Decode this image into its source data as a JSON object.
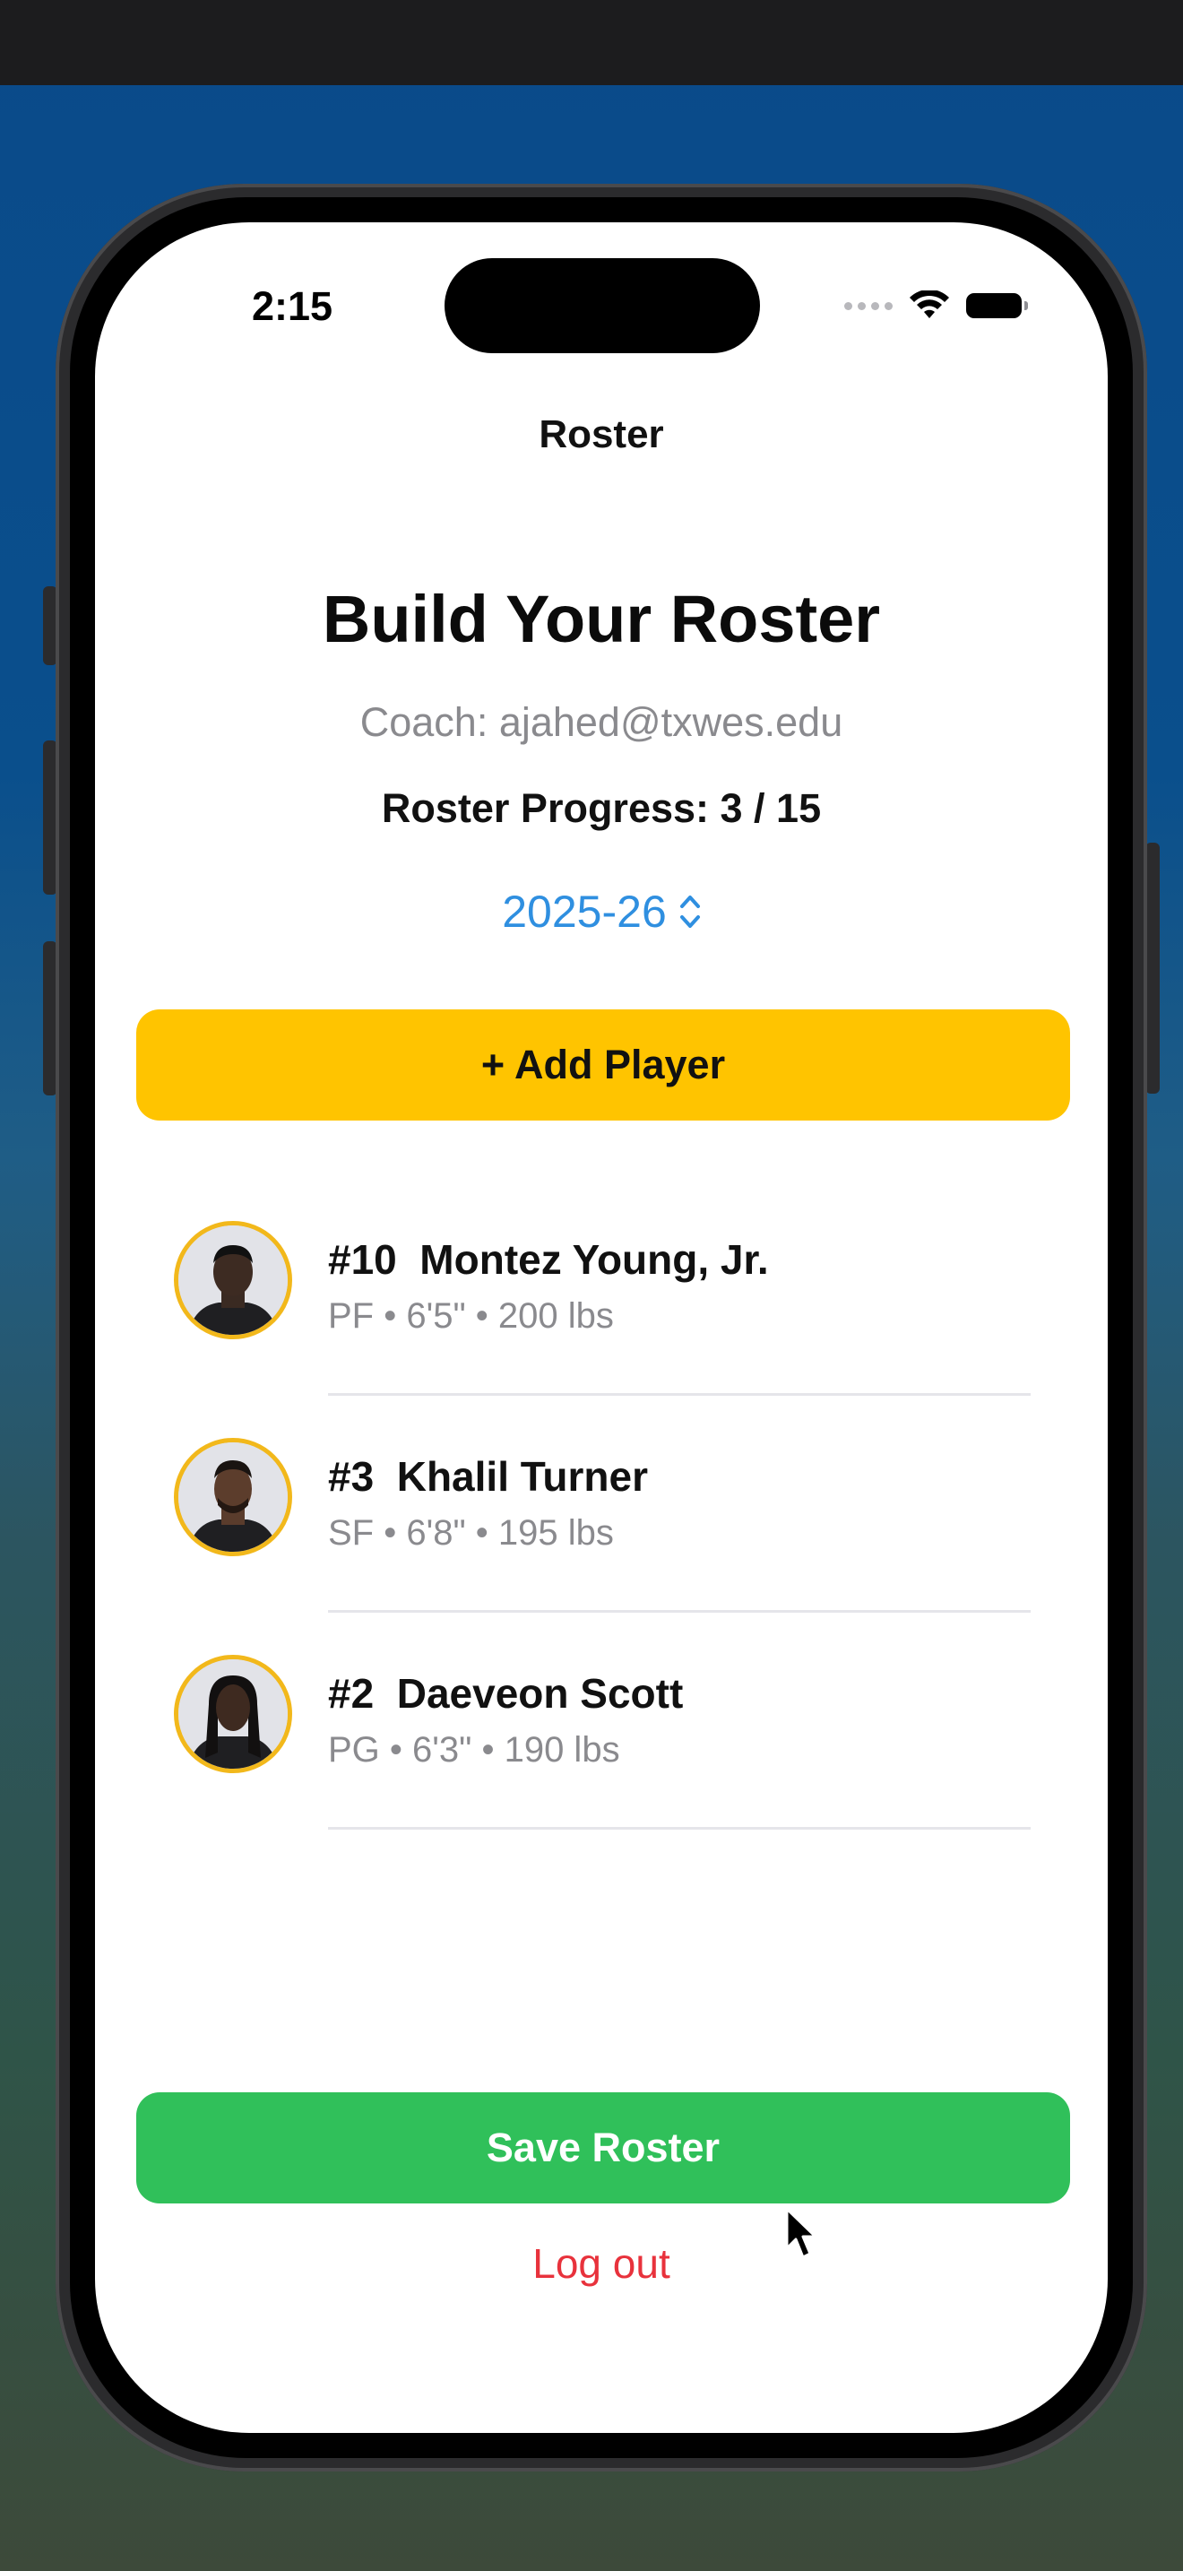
{
  "status_bar": {
    "time": "2:15",
    "icons": [
      "cellular-dots-icon",
      "wifi-icon",
      "battery-icon"
    ]
  },
  "nav": {
    "title": "Roster"
  },
  "header": {
    "title": "Build Your Roster",
    "coach": "Coach: ajahed@txwes.edu",
    "progress": "Roster Progress: 3 / 15"
  },
  "season_picker": {
    "value": "2025-26",
    "icon": "chevron-up-down-icon"
  },
  "add_button": {
    "label": "+ Add Player"
  },
  "players": [
    {
      "name": "#10  Montez Young, Jr.",
      "meta": "PF • 6'5\" • 200 lbs"
    },
    {
      "name": "#3  Khalil Turner",
      "meta": "SF • 6'8\" • 195 lbs"
    },
    {
      "name": "#2  Daeveon Scott",
      "meta": "PG • 6'3\" • 190 lbs"
    }
  ],
  "save_button": {
    "label": "Save Roster"
  },
  "logout": {
    "label": "Log out"
  },
  "colors": {
    "accent_yellow": "#ffc400",
    "save_green": "#30c05a",
    "link_blue": "#2f8fe0",
    "logout_red": "#e8323c",
    "avatar_ring": "#f2b81b"
  }
}
